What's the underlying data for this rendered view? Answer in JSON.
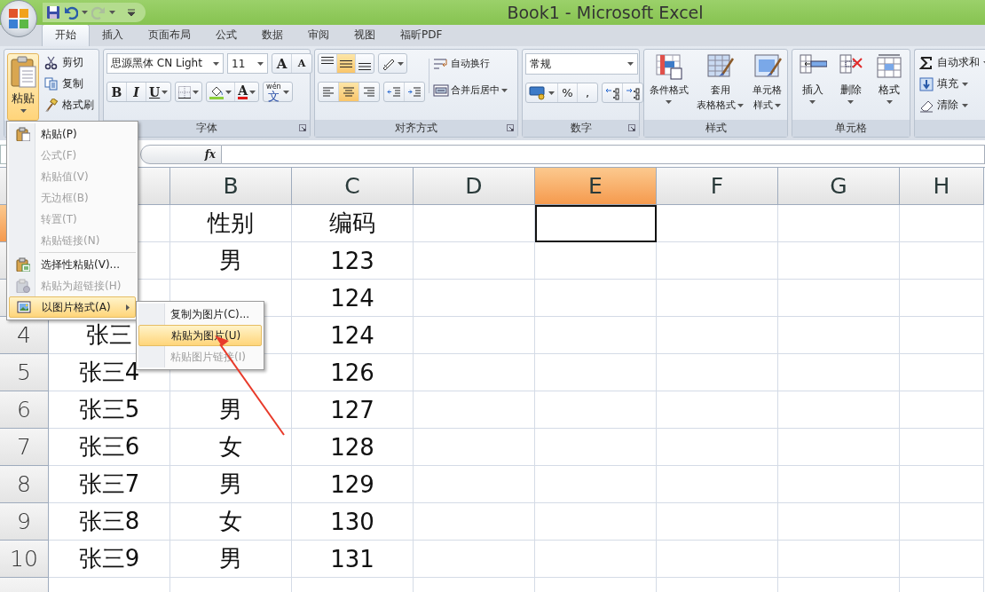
{
  "window": {
    "title": "Book1 - Microsoft Excel"
  },
  "tabs": [
    {
      "label": "开始",
      "selected": true
    },
    {
      "label": "插入",
      "selected": false
    },
    {
      "label": "页面布局",
      "selected": false
    },
    {
      "label": "公式",
      "selected": false
    },
    {
      "label": "数据",
      "selected": false
    },
    {
      "label": "审阅",
      "selected": false
    },
    {
      "label": "视图",
      "selected": false
    },
    {
      "label": "福昕PDF",
      "selected": false
    }
  ],
  "clipboard": {
    "paste": {
      "label": "粘贴",
      "open": true
    },
    "small": [
      {
        "kind": "cut",
        "label": "剪切"
      },
      {
        "kind": "copy",
        "label": "复制"
      },
      {
        "kind": "painter",
        "label": "格式刷"
      }
    ]
  },
  "font": {
    "label": "字体",
    "font_name": "思源黑体 CN Light",
    "font_size": "11",
    "grow": "A",
    "shrink": "A",
    "styles": [
      {
        "kind": "bold",
        "label": "B"
      },
      {
        "kind": "italic",
        "label": "I"
      },
      {
        "kind": "underline",
        "label": "U"
      }
    ],
    "font_color": "A",
    "phonetic": {
      "pinyin": "wén",
      "char": "文"
    }
  },
  "alignment": {
    "label": "对齐方式",
    "vertical": [
      {
        "kind": "top",
        "selected": false
      },
      {
        "kind": "middle",
        "selected": true
      },
      {
        "kind": "bottom",
        "selected": false
      }
    ],
    "horizontal": [
      {
        "kind": "left",
        "selected": false
      },
      {
        "kind": "center",
        "selected": true
      },
      {
        "kind": "right",
        "selected": false
      }
    ],
    "wrap_text": "自动换行",
    "merge_center": "合并后居中"
  },
  "number": {
    "label": "数字",
    "format": "常规",
    "percent": "%",
    "comma": ","
  },
  "styles": {
    "label": "样式",
    "items": [
      {
        "kind": "conditional",
        "lines": [
          "条件格式"
        ]
      },
      {
        "kind": "table",
        "lines": [
          "套用",
          "表格格式"
        ]
      },
      {
        "kind": "cell",
        "lines": [
          "单元格",
          "样式"
        ]
      }
    ]
  },
  "cells": {
    "label": "单元格",
    "items": [
      {
        "kind": "insert",
        "label": "插入"
      },
      {
        "kind": "delete",
        "label": "删除"
      },
      {
        "kind": "format",
        "label": "格式"
      }
    ]
  },
  "editing": {
    "items": [
      {
        "kind": "sum",
        "label": "自动求和"
      },
      {
        "kind": "fill",
        "label": "填充"
      },
      {
        "kind": "clear",
        "label": "清除"
      }
    ]
  },
  "formula_bar": {
    "fx": "fx"
  },
  "columns": [
    {
      "selected": false
    },
    {
      "label": "B",
      "selected": false
    },
    {
      "label": "C",
      "selected": false
    },
    {
      "label": "D",
      "selected": false
    },
    {
      "label": "E",
      "selected": true
    },
    {
      "label": "F",
      "selected": false
    },
    {
      "label": "G",
      "selected": false
    },
    {
      "label": "H",
      "selected": false
    }
  ],
  "rows": [
    {
      "selected": true,
      "cells": {
        "B": "性别",
        "C": "编码"
      }
    },
    {
      "selected": false,
      "cells": {
        "B": "男",
        "C": "123"
      }
    },
    {
      "selected": false,
      "cells": {
        "C": "124"
      }
    },
    {
      "header": "4",
      "selected": false,
      "cells": {
        "A": "张三",
        "C": "124"
      }
    },
    {
      "header": "5",
      "selected": false,
      "cells": {
        "A": "张三4",
        "C": "126"
      }
    },
    {
      "header": "6",
      "selected": false,
      "cells": {
        "A": "张三5",
        "B": "男",
        "C": "127"
      }
    },
    {
      "header": "7",
      "selected": false,
      "cells": {
        "A": "张三6",
        "B": "女",
        "C": "128"
      }
    },
    {
      "header": "8",
      "selected": false,
      "cells": {
        "A": "张三7",
        "B": "男",
        "C": "129"
      }
    },
    {
      "header": "9",
      "selected": false,
      "cells": {
        "A": "张三8",
        "B": "女",
        "C": "130"
      }
    },
    {
      "header": "10",
      "selected": false,
      "cells": {
        "A": "张三9",
        "B": "男",
        "C": "131"
      }
    },
    {
      "selected": false,
      "cells": {}
    }
  ],
  "paste_menu": {
    "items": [
      {
        "kind": "paste",
        "label": "粘贴(P)",
        "disabled": false,
        "selected": false
      },
      {
        "label": "公式(F)",
        "disabled": true,
        "selected": false
      },
      {
        "label": "粘贴值(V)",
        "disabled": true,
        "selected": false
      },
      {
        "label": "无边框(B)",
        "disabled": true,
        "selected": false
      },
      {
        "label": "转置(T)",
        "disabled": true,
        "selected": false
      },
      {
        "label": "粘贴链接(N)",
        "disabled": true,
        "selected": false
      },
      {
        "kind": "separator"
      },
      {
        "kind": "special",
        "label": "选择性粘贴(V)...",
        "disabled": false,
        "selected": false
      },
      {
        "kind": "hyperlink",
        "label": "粘贴为超链接(H)",
        "disabled": true,
        "selected": false
      },
      {
        "kind": "picture",
        "label": "以图片格式(A)",
        "disabled": false,
        "selected": true,
        "submenu": true
      }
    ],
    "submenu": [
      {
        "label": "复制为图片(C)...",
        "disabled": false,
        "selected": false
      },
      {
        "label": "粘贴为图片(U)",
        "disabled": false,
        "selected": true
      },
      {
        "label": "粘贴图片链接(I)",
        "disabled": true,
        "selected": false
      }
    ]
  }
}
